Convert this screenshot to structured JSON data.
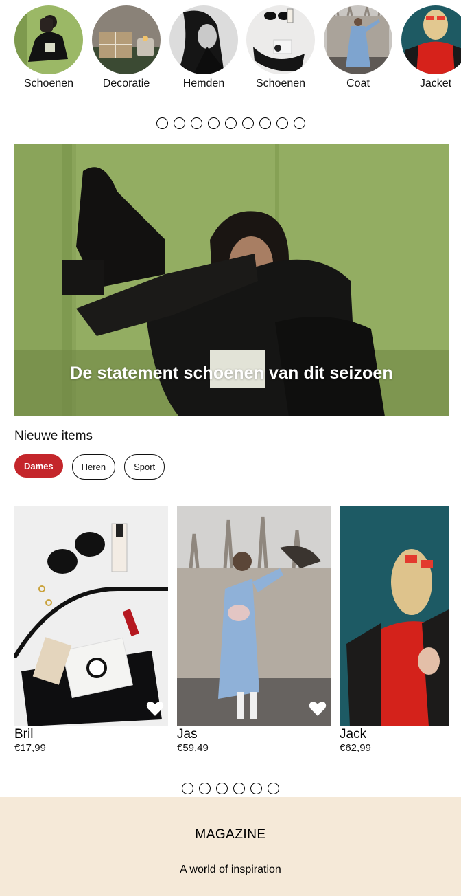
{
  "categories": [
    {
      "label": "Schoenen"
    },
    {
      "label": "Decoratie"
    },
    {
      "label": "Hemden"
    },
    {
      "label": "Schoenen"
    },
    {
      "label": "Coat"
    },
    {
      "label": "Jacket"
    }
  ],
  "category_dots_count": 9,
  "hero": {
    "title": "De statement schoenen van dit seizoen"
  },
  "new_items": {
    "title": "Nieuwe items",
    "filters": [
      {
        "label": "Dames",
        "active": true
      },
      {
        "label": "Heren",
        "active": false
      },
      {
        "label": "Sport",
        "active": false
      }
    ]
  },
  "products": [
    {
      "name": "Bril",
      "price": "€17,99"
    },
    {
      "name": "Jas",
      "price": "€59,49"
    },
    {
      "name": "Jack",
      "price": "€62,99"
    }
  ],
  "product_dots_count": 6,
  "magazine": {
    "title": "MAGAZINE",
    "subtitle": "A world of inspiration"
  },
  "colors": {
    "accent": "#c4262b",
    "magazine_bg": "#f5e9d8",
    "hero_green": "#8fa860"
  }
}
